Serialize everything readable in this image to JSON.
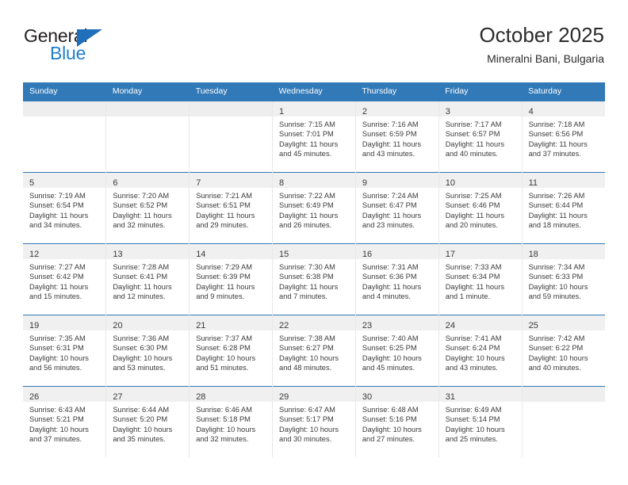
{
  "brand": {
    "name_part1": "General",
    "name_part2": "Blue",
    "triangle_icon": "blue-triangle-icon",
    "color_dark": "#231f20",
    "color_blue": "#1f7fd0"
  },
  "header": {
    "title": "October 2025",
    "subtitle": "Mineralni Bani, Bulgaria",
    "accent_color": "#3279b7"
  },
  "calendar": {
    "weekday_headers": [
      "Sunday",
      "Monday",
      "Tuesday",
      "Wednesday",
      "Thursday",
      "Friday",
      "Saturday"
    ],
    "labels": {
      "sunrise_prefix": "Sunrise:",
      "sunset_prefix": "Sunset:",
      "daylight_prefix": "Daylight:"
    },
    "weeks": [
      [
        {
          "day": "",
          "sunrise": "",
          "sunset": "",
          "daylight_line1": "",
          "daylight_line2": "",
          "empty": true
        },
        {
          "day": "",
          "sunrise": "",
          "sunset": "",
          "daylight_line1": "",
          "daylight_line2": "",
          "empty": true
        },
        {
          "day": "",
          "sunrise": "",
          "sunset": "",
          "daylight_line1": "",
          "daylight_line2": "",
          "empty": true
        },
        {
          "day": "1",
          "sunrise": "Sunrise: 7:15 AM",
          "sunset": "Sunset: 7:01 PM",
          "daylight_line1": "Daylight: 11 hours",
          "daylight_line2": "and 45 minutes."
        },
        {
          "day": "2",
          "sunrise": "Sunrise: 7:16 AM",
          "sunset": "Sunset: 6:59 PM",
          "daylight_line1": "Daylight: 11 hours",
          "daylight_line2": "and 43 minutes."
        },
        {
          "day": "3",
          "sunrise": "Sunrise: 7:17 AM",
          "sunset": "Sunset: 6:57 PM",
          "daylight_line1": "Daylight: 11 hours",
          "daylight_line2": "and 40 minutes."
        },
        {
          "day": "4",
          "sunrise": "Sunrise: 7:18 AM",
          "sunset": "Sunset: 6:56 PM",
          "daylight_line1": "Daylight: 11 hours",
          "daylight_line2": "and 37 minutes."
        }
      ],
      [
        {
          "day": "5",
          "sunrise": "Sunrise: 7:19 AM",
          "sunset": "Sunset: 6:54 PM",
          "daylight_line1": "Daylight: 11 hours",
          "daylight_line2": "and 34 minutes."
        },
        {
          "day": "6",
          "sunrise": "Sunrise: 7:20 AM",
          "sunset": "Sunset: 6:52 PM",
          "daylight_line1": "Daylight: 11 hours",
          "daylight_line2": "and 32 minutes."
        },
        {
          "day": "7",
          "sunrise": "Sunrise: 7:21 AM",
          "sunset": "Sunset: 6:51 PM",
          "daylight_line1": "Daylight: 11 hours",
          "daylight_line2": "and 29 minutes."
        },
        {
          "day": "8",
          "sunrise": "Sunrise: 7:22 AM",
          "sunset": "Sunset: 6:49 PM",
          "daylight_line1": "Daylight: 11 hours",
          "daylight_line2": "and 26 minutes."
        },
        {
          "day": "9",
          "sunrise": "Sunrise: 7:24 AM",
          "sunset": "Sunset: 6:47 PM",
          "daylight_line1": "Daylight: 11 hours",
          "daylight_line2": "and 23 minutes."
        },
        {
          "day": "10",
          "sunrise": "Sunrise: 7:25 AM",
          "sunset": "Sunset: 6:46 PM",
          "daylight_line1": "Daylight: 11 hours",
          "daylight_line2": "and 20 minutes."
        },
        {
          "day": "11",
          "sunrise": "Sunrise: 7:26 AM",
          "sunset": "Sunset: 6:44 PM",
          "daylight_line1": "Daylight: 11 hours",
          "daylight_line2": "and 18 minutes."
        }
      ],
      [
        {
          "day": "12",
          "sunrise": "Sunrise: 7:27 AM",
          "sunset": "Sunset: 6:42 PM",
          "daylight_line1": "Daylight: 11 hours",
          "daylight_line2": "and 15 minutes."
        },
        {
          "day": "13",
          "sunrise": "Sunrise: 7:28 AM",
          "sunset": "Sunset: 6:41 PM",
          "daylight_line1": "Daylight: 11 hours",
          "daylight_line2": "and 12 minutes."
        },
        {
          "day": "14",
          "sunrise": "Sunrise: 7:29 AM",
          "sunset": "Sunset: 6:39 PM",
          "daylight_line1": "Daylight: 11 hours",
          "daylight_line2": "and 9 minutes."
        },
        {
          "day": "15",
          "sunrise": "Sunrise: 7:30 AM",
          "sunset": "Sunset: 6:38 PM",
          "daylight_line1": "Daylight: 11 hours",
          "daylight_line2": "and 7 minutes."
        },
        {
          "day": "16",
          "sunrise": "Sunrise: 7:31 AM",
          "sunset": "Sunset: 6:36 PM",
          "daylight_line1": "Daylight: 11 hours",
          "daylight_line2": "and 4 minutes."
        },
        {
          "day": "17",
          "sunrise": "Sunrise: 7:33 AM",
          "sunset": "Sunset: 6:34 PM",
          "daylight_line1": "Daylight: 11 hours",
          "daylight_line2": "and 1 minute."
        },
        {
          "day": "18",
          "sunrise": "Sunrise: 7:34 AM",
          "sunset": "Sunset: 6:33 PM",
          "daylight_line1": "Daylight: 10 hours",
          "daylight_line2": "and 59 minutes."
        }
      ],
      [
        {
          "day": "19",
          "sunrise": "Sunrise: 7:35 AM",
          "sunset": "Sunset: 6:31 PM",
          "daylight_line1": "Daylight: 10 hours",
          "daylight_line2": "and 56 minutes."
        },
        {
          "day": "20",
          "sunrise": "Sunrise: 7:36 AM",
          "sunset": "Sunset: 6:30 PM",
          "daylight_line1": "Daylight: 10 hours",
          "daylight_line2": "and 53 minutes."
        },
        {
          "day": "21",
          "sunrise": "Sunrise: 7:37 AM",
          "sunset": "Sunset: 6:28 PM",
          "daylight_line1": "Daylight: 10 hours",
          "daylight_line2": "and 51 minutes."
        },
        {
          "day": "22",
          "sunrise": "Sunrise: 7:38 AM",
          "sunset": "Sunset: 6:27 PM",
          "daylight_line1": "Daylight: 10 hours",
          "daylight_line2": "and 48 minutes."
        },
        {
          "day": "23",
          "sunrise": "Sunrise: 7:40 AM",
          "sunset": "Sunset: 6:25 PM",
          "daylight_line1": "Daylight: 10 hours",
          "daylight_line2": "and 45 minutes."
        },
        {
          "day": "24",
          "sunrise": "Sunrise: 7:41 AM",
          "sunset": "Sunset: 6:24 PM",
          "daylight_line1": "Daylight: 10 hours",
          "daylight_line2": "and 43 minutes."
        },
        {
          "day": "25",
          "sunrise": "Sunrise: 7:42 AM",
          "sunset": "Sunset: 6:22 PM",
          "daylight_line1": "Daylight: 10 hours",
          "daylight_line2": "and 40 minutes."
        }
      ],
      [
        {
          "day": "26",
          "sunrise": "Sunrise: 6:43 AM",
          "sunset": "Sunset: 5:21 PM",
          "daylight_line1": "Daylight: 10 hours",
          "daylight_line2": "and 37 minutes."
        },
        {
          "day": "27",
          "sunrise": "Sunrise: 6:44 AM",
          "sunset": "Sunset: 5:20 PM",
          "daylight_line1": "Daylight: 10 hours",
          "daylight_line2": "and 35 minutes."
        },
        {
          "day": "28",
          "sunrise": "Sunrise: 6:46 AM",
          "sunset": "Sunset: 5:18 PM",
          "daylight_line1": "Daylight: 10 hours",
          "daylight_line2": "and 32 minutes."
        },
        {
          "day": "29",
          "sunrise": "Sunrise: 6:47 AM",
          "sunset": "Sunset: 5:17 PM",
          "daylight_line1": "Daylight: 10 hours",
          "daylight_line2": "and 30 minutes."
        },
        {
          "day": "30",
          "sunrise": "Sunrise: 6:48 AM",
          "sunset": "Sunset: 5:16 PM",
          "daylight_line1": "Daylight: 10 hours",
          "daylight_line2": "and 27 minutes."
        },
        {
          "day": "31",
          "sunrise": "Sunrise: 6:49 AM",
          "sunset": "Sunset: 5:14 PM",
          "daylight_line1": "Daylight: 10 hours",
          "daylight_line2": "and 25 minutes."
        },
        {
          "day": "",
          "sunrise": "",
          "sunset": "",
          "daylight_line1": "",
          "daylight_line2": "",
          "empty": true
        }
      ]
    ]
  }
}
